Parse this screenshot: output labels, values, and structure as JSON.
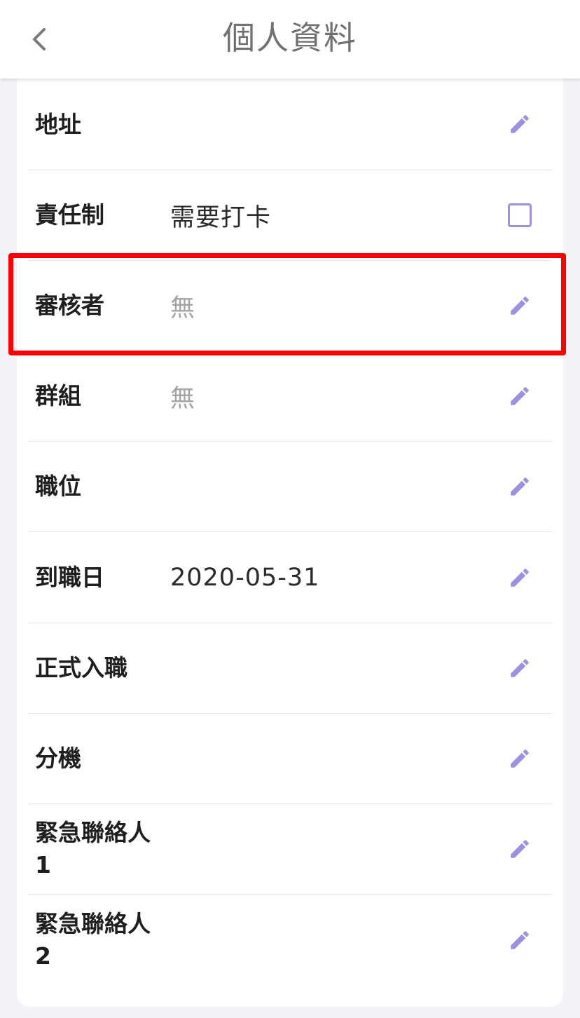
{
  "header": {
    "title": "個人資料",
    "back_icon": "chevron-left-icon"
  },
  "rows": [
    {
      "label": "地址",
      "value": "",
      "action": "edit"
    },
    {
      "label": "責任制",
      "value": "需要打卡",
      "action": "checkbox",
      "checked": false
    },
    {
      "label": "審核者",
      "value": "無",
      "muted": true,
      "action": "edit",
      "highlighted": true
    },
    {
      "label": "群組",
      "value": "無",
      "muted": true,
      "action": "edit"
    },
    {
      "label": "職位",
      "value": "",
      "action": "edit"
    },
    {
      "label": "到職日",
      "value": "2020-05-31",
      "action": "edit"
    },
    {
      "label": "正式入職",
      "value": "",
      "action": "edit"
    },
    {
      "label": "分機",
      "value": "",
      "action": "edit"
    },
    {
      "label": "緊急聯絡人",
      "label_line2": "1",
      "value": "",
      "action": "edit"
    },
    {
      "label": "緊急聯絡人",
      "label_line2": "2",
      "value": "",
      "action": "edit"
    }
  ],
  "colors": {
    "accent": "#9f8fe3",
    "highlight": "#ff0000",
    "muted_text": "#a3a3a3"
  }
}
